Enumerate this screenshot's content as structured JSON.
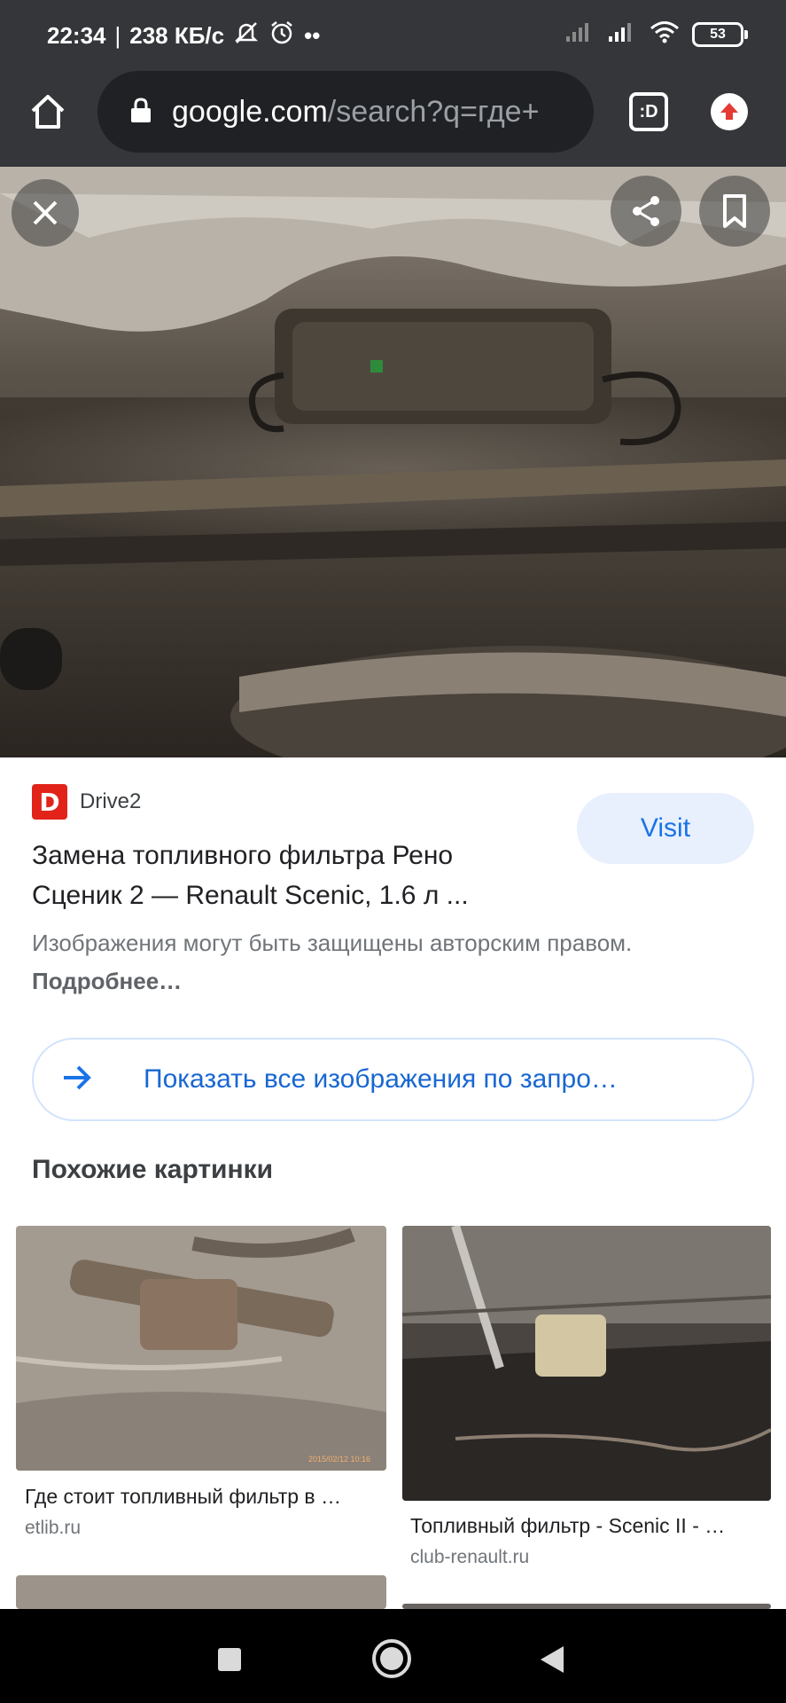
{
  "status_bar": {
    "time": "22:34",
    "separator": "|",
    "speed": "238 КБ/с",
    "more": "••",
    "battery": "53"
  },
  "toolbar": {
    "url_domain": "google.com",
    "url_path": "/search?q=где+",
    "tab_label": ":D"
  },
  "result": {
    "source_logo": "D",
    "source_name": "Drive2",
    "title": "Замена топливного фильтра Рено Сценик 2 — Renault Scenic, 1.6 л ...",
    "visit_label": "Visit",
    "copyright_text": "Изображения могут быть защищены авторским правом.",
    "copyright_link": "Подробнее…"
  },
  "show_all_label": "Показать все изображения по запро…",
  "similar": {
    "heading": "Похожие картинки",
    "items": [
      {
        "title": "Где стоит топливный фильтр в …",
        "domain": "etlib.ru",
        "stamp": "2015/02/12 10:16"
      },
      {
        "title": "Топливный фильтр - Scenic II - …",
        "domain": "club-renault.ru"
      }
    ]
  },
  "colors": {
    "chrome_dark": "#35363a",
    "url_bar": "#202124",
    "accent_blue": "#1a73e8",
    "visit_bg": "#e8f0fe",
    "drive2_red": "#e2231a"
  }
}
